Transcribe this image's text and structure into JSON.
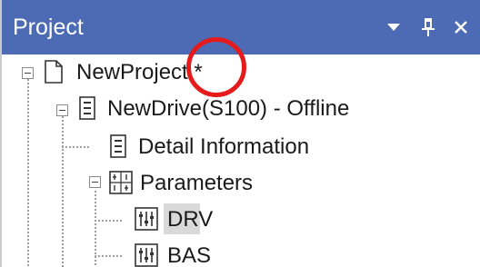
{
  "panel": {
    "title": "Project",
    "colors": {
      "titlebar_bg": "#4c6bb4",
      "selection_bg": "#d9d9d9",
      "annotation": "#e51b1b"
    },
    "buttons": [
      {
        "icon": "dropdown-arrow-icon"
      },
      {
        "icon": "pin-icon"
      },
      {
        "icon": "close-icon"
      }
    ]
  },
  "tree": {
    "root": {
      "label": "NewProject *",
      "icon": "document-icon",
      "expanded": true
    },
    "drive": {
      "label": "NewDrive(S100) - Offline",
      "icon": "drive-icon",
      "expanded": true
    },
    "detail": {
      "label": "Detail Information",
      "icon": "drive-icon"
    },
    "parameters": {
      "label": "Parameters",
      "icon": "parameters-grid-icon",
      "expanded": true
    },
    "drv": {
      "label": "DRV",
      "icon": "parameter-group-icon",
      "selected": true
    },
    "bas": {
      "label": "BAS",
      "icon": "parameter-group-icon"
    }
  }
}
